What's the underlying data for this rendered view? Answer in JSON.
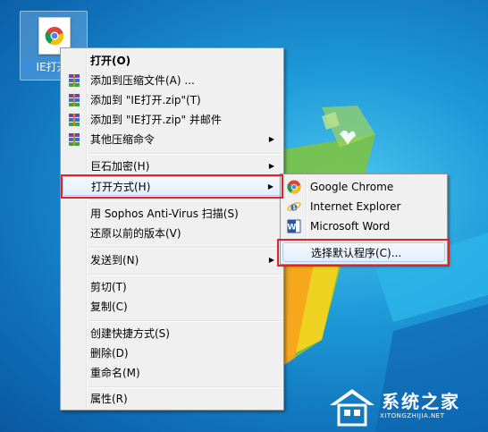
{
  "desktop": {
    "file": {
      "label": "IE打开.",
      "icon": "chrome-file-icon"
    }
  },
  "context_menu": {
    "items": [
      {
        "label": "打开(O)",
        "icon": null,
        "submenu": false
      },
      {
        "label": "添加到压缩文件(A) ...",
        "icon": "winrar-icon",
        "submenu": false
      },
      {
        "label": "添加到 \"IE打开.zip\"(T)",
        "icon": "winrar-icon",
        "submenu": false
      },
      {
        "label": "添加到 \"IE打开.zip\" 并邮件",
        "icon": "winrar-icon",
        "submenu": false
      },
      {
        "label": "其他压缩命令",
        "icon": "winrar-icon",
        "submenu": true
      },
      {
        "label": "巨石加密(H)",
        "icon": null,
        "submenu": true
      },
      {
        "label": "打开方式(H)",
        "icon": null,
        "submenu": true
      },
      {
        "label": "用 Sophos Anti-Virus 扫描(S)",
        "icon": null,
        "submenu": false
      },
      {
        "label": "还原以前的版本(V)",
        "icon": null,
        "submenu": false
      },
      {
        "label": "发送到(N)",
        "icon": null,
        "submenu": true
      },
      {
        "label": "剪切(T)",
        "icon": null,
        "submenu": false
      },
      {
        "label": "复制(C)",
        "icon": null,
        "submenu": false
      },
      {
        "label": "创建快捷方式(S)",
        "icon": null,
        "submenu": false
      },
      {
        "label": "删除(D)",
        "icon": null,
        "submenu": false
      },
      {
        "label": "重命名(M)",
        "icon": null,
        "submenu": false
      },
      {
        "label": "属性(R)",
        "icon": null,
        "submenu": false
      }
    ]
  },
  "open_with_menu": {
    "items": [
      {
        "label": "Google Chrome",
        "icon": "chrome-icon"
      },
      {
        "label": "Internet Explorer",
        "icon": "ie-icon"
      },
      {
        "label": "Microsoft Word",
        "icon": "word-icon"
      },
      {
        "label": "选择默认程序(C)...",
        "icon": null
      }
    ]
  },
  "watermark": {
    "title": "系统之家",
    "subtitle": "XITONGZHIJIA.NET"
  },
  "colors": {
    "highlight_border": "#e0232a",
    "menu_bg": "#f0f0f0",
    "desktop": "#1f9bd9"
  }
}
